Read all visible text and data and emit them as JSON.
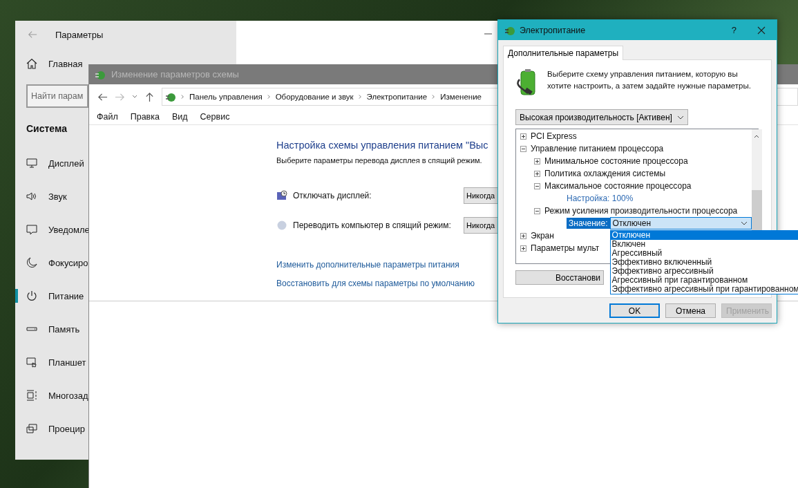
{
  "settings_window": {
    "title": "Параметры",
    "home": "Главная",
    "search": {
      "placeholder": "Найти парам"
    },
    "section": "Система",
    "items": [
      {
        "label": "Дисплей",
        "selected": false
      },
      {
        "label": "Звук",
        "selected": false
      },
      {
        "label": "Уведомле",
        "selected": false
      },
      {
        "label": "Фокусиро",
        "selected": false
      },
      {
        "label": "Питание",
        "selected": true
      },
      {
        "label": "Память",
        "selected": false
      },
      {
        "label": "Планшет",
        "selected": false
      },
      {
        "label": "Многозад",
        "selected": false
      },
      {
        "label": "Проецир",
        "selected": false
      }
    ]
  },
  "explorer_window": {
    "title": "Изменение параметров схемы",
    "breadcrumbs": [
      "Панель управления",
      "Оборудование и звук",
      "Электропитание",
      "Изменение"
    ],
    "menu": [
      "Файл",
      "Правка",
      "Вид",
      "Сервис"
    ],
    "heading": "Настройка схемы управления питанием \"Выс",
    "subtitle": "Выберите параметры перевода дисплея в спящий режим.",
    "rows": [
      {
        "label": "Отключать дисплей:",
        "value": "Никогда"
      },
      {
        "label": "Переводить компьютер в спящий режим:",
        "value": "Никогда"
      }
    ],
    "links": [
      "Изменить дополнительные параметры питания",
      "Восстановить для схемы параметры по умолчанию"
    ]
  },
  "power_dialog": {
    "title": "Электропитание",
    "help": "?",
    "tabs": [
      {
        "label": "Дополнительные параметры",
        "selected": true
      }
    ],
    "description": "Выберите схему управления питанием, которую вы хотите настроить, а затем задайте нужные параметры.",
    "plan": "Высокая производительность [Активен]",
    "tree": [
      {
        "kind": "group",
        "label": "PCI Express",
        "expanded": false
      },
      {
        "kind": "group",
        "label": "Управление питанием процессора",
        "expanded": true,
        "children": [
          {
            "kind": "group",
            "label": "Минимальное состояние процессора",
            "expanded": false
          },
          {
            "kind": "group",
            "label": "Политика охлаждения системы",
            "expanded": false
          },
          {
            "kind": "group",
            "label": "Максимальное состояние процессора",
            "expanded": true,
            "children": [
              {
                "kind": "setting",
                "label": "Настройка: 100%"
              }
            ]
          },
          {
            "kind": "group",
            "label": "Режим усиления производительности процессора",
            "expanded": true,
            "children": [
              {
                "kind": "value",
                "label": "Значение:",
                "value": "Отключен",
                "expanded": true
              }
            ]
          }
        ]
      },
      {
        "kind": "group",
        "label": "Экран",
        "expanded": false
      },
      {
        "kind": "group",
        "label": "Параметры мульт",
        "expanded": false
      }
    ],
    "options": [
      {
        "label": "Отключен",
        "selected": true
      },
      {
        "label": "Включен",
        "selected": false
      },
      {
        "label": "Агрессивный",
        "selected": false
      },
      {
        "label": "Эффективно включенный",
        "selected": false
      },
      {
        "label": "Эффективно агрессивный",
        "selected": false
      },
      {
        "label": "Агрессивный при гарантированном",
        "selected": false
      },
      {
        "label": "Эффективно агрессивный при гарантированном",
        "selected": false
      }
    ],
    "restore_button": "Восстанови",
    "buttons": [
      {
        "label": "OK",
        "default": true,
        "disabled": false
      },
      {
        "label": "Отмена",
        "default": false,
        "disabled": false
      },
      {
        "label": "Применить",
        "default": false,
        "disabled": true
      }
    ]
  }
}
